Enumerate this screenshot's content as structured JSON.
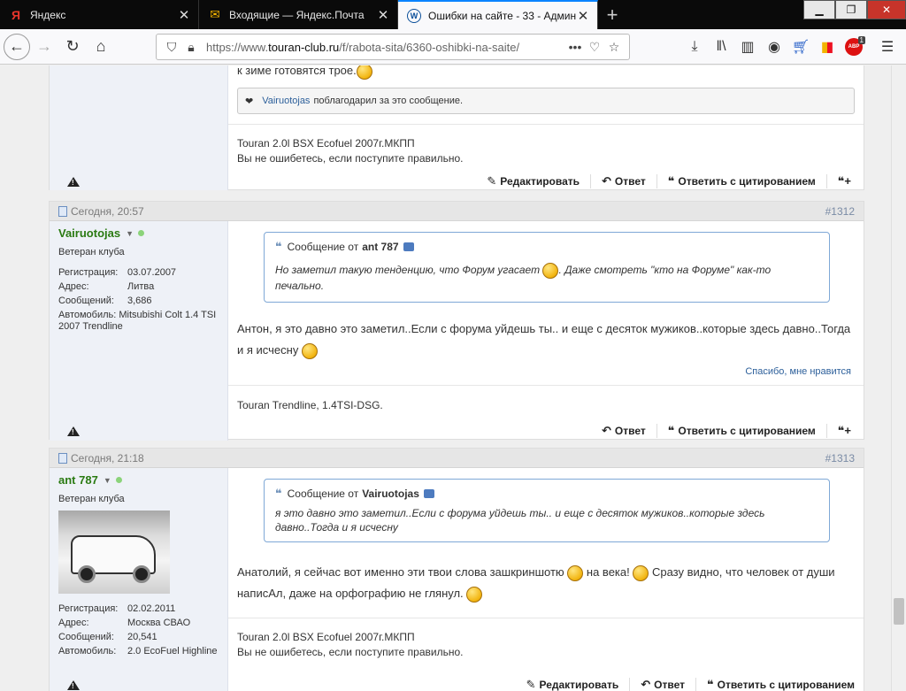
{
  "browser": {
    "tabs": [
      {
        "title": "Яндекс",
        "active": false
      },
      {
        "title": "Входящие — Яндекс.Почта",
        "active": false
      },
      {
        "title": "Ошибки на сайте - 33 - Админ",
        "active": true
      }
    ],
    "url_prefix": "https://www.",
    "url_domain": "touran-club.ru",
    "url_path": "/f/rabota-sita/6360-oshibki-na-saite/",
    "adblock_badge": "1",
    "adblock_label": "ABP"
  },
  "post0": {
    "tail_text": "к зиме готовятся трое.",
    "thanks_user": "Vairuotojas",
    "thanks_text": "поблагодарил за это сообщение.",
    "sig_line1": "Touran 2.0l BSX Ecofuel 2007г.МКПП",
    "sig_line2": "Вы не ошибетесь, если поступите правильно.",
    "actions": [
      "Редактировать",
      "Ответ",
      "Ответить с цитированием"
    ]
  },
  "post1": {
    "date": "Сегодня, 20:57",
    "number": "#1312",
    "username": "Vairuotojas",
    "rank": "Ветеран клуба",
    "info": [
      {
        "label": "Регистрация:",
        "value": "03.07.2007"
      },
      {
        "label": "Адрес:",
        "value": "Литва"
      },
      {
        "label": "Сообщений:",
        "value": "3,686"
      },
      {
        "label": "Автомобиль:",
        "value": "Mitsubishi Colt 1.4 TSI 2007 Trendline"
      }
    ],
    "quote_prefix": "Сообщение от",
    "quote_author": "ant 787",
    "quote_text_a": "Но заметил такую тенденцию, что Форум угасает",
    "quote_text_b": ". Даже смотреть \"кто на Форуме\" как-то печально.",
    "message": "Антон, я это давно это заметил..Если с форума уйдешь ты.. и еще с десяток мужиков..которые здесь давно..Тогда и я исчесну",
    "like_text": "Спасибо, мне нравится",
    "signature": "Touran Trendline, 1.4TSI-DSG.",
    "actions": [
      "Ответ",
      "Ответить с цитированием"
    ]
  },
  "post2": {
    "date": "Сегодня, 21:18",
    "number": "#1313",
    "username": "ant 787",
    "rank": "Ветеран клуба",
    "info": [
      {
        "label": "Регистрация:",
        "value": "02.02.2011"
      },
      {
        "label": "Адрес:",
        "value": "Москва СВАО"
      },
      {
        "label": "Сообщений:",
        "value": "20,541"
      },
      {
        "label": "Автомобиль:",
        "value": "2.0 EcoFuel Highline"
      }
    ],
    "quote_prefix": "Сообщение от",
    "quote_author": "Vairuotojas",
    "quote_text": "я это давно это заметил..Если с форума уйдешь ты.. и еще с десяток мужиков..которые здесь давно..Тогда и я исчесну",
    "message_a": "Анатолий, я сейчас вот именно эти твои слова зашкриншотю",
    "message_b": "на века!",
    "message_c": "Сразу видно, что человек от души написАл, даже на орфографию не глянул.",
    "sig_line1": "Touran 2.0l BSX Ecofuel 2007г.МКПП",
    "sig_line2": "Вы не ошибетесь, если поступите правильно.",
    "actions": [
      "Редактировать",
      "Ответ",
      "Ответить с цитированием"
    ]
  }
}
